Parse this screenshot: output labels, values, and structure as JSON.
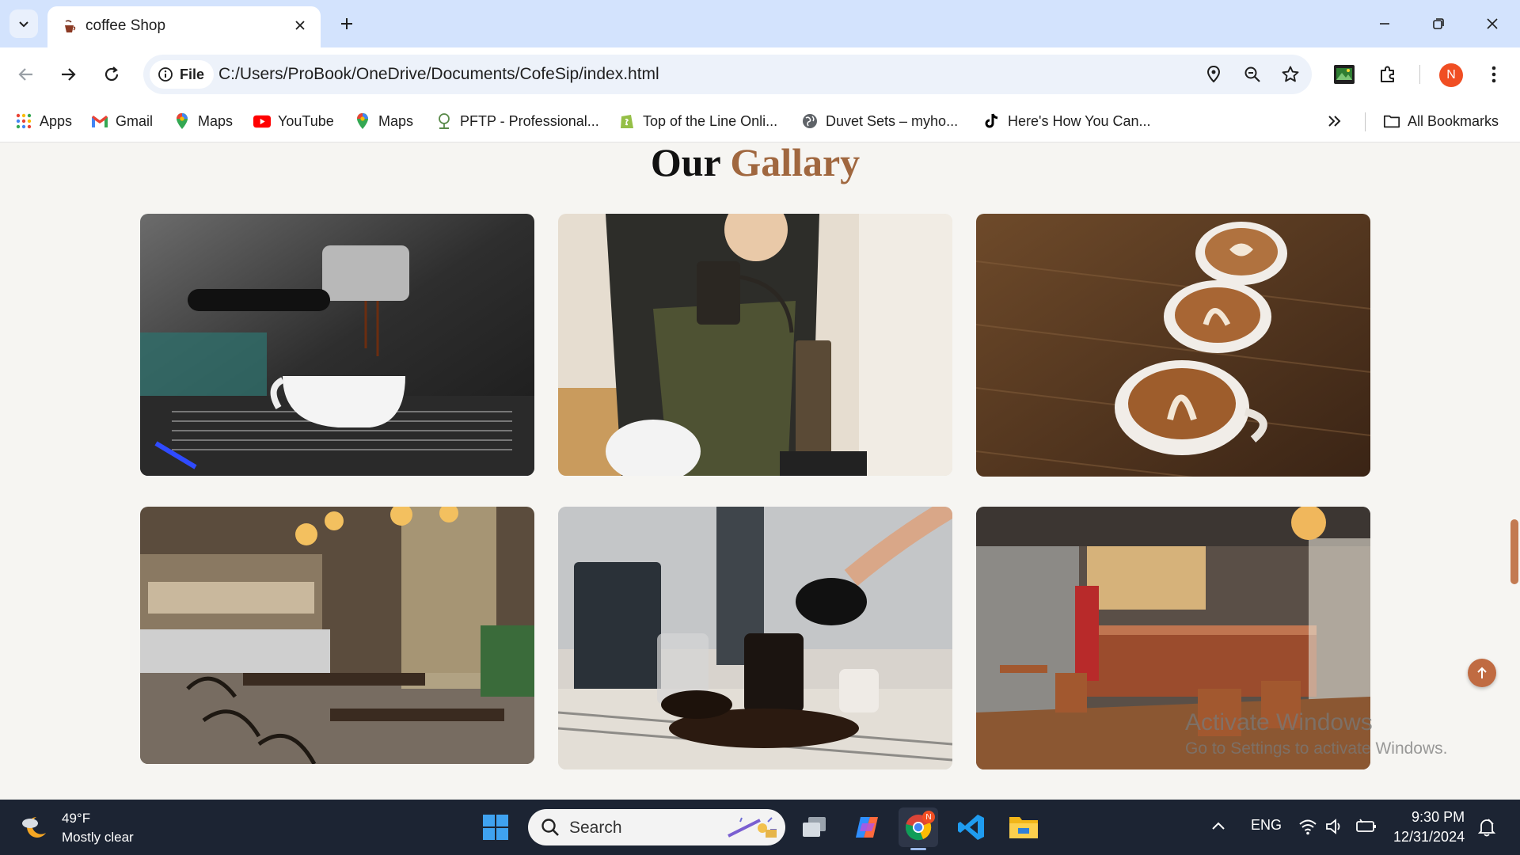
{
  "browser": {
    "tab": {
      "title": "coffee Shop"
    },
    "omnibox": {
      "security_chip": "File",
      "url": "C:/Users/ProBook/OneDrive/Documents/CofeSip/index.html"
    },
    "profile_initial": "N",
    "bookmarks": [
      {
        "label": "Apps",
        "icon": "apps-grid-icon"
      },
      {
        "label": "Gmail",
        "icon": "gmail-icon"
      },
      {
        "label": "Maps",
        "icon": "maps-pin-icon"
      },
      {
        "label": "YouTube",
        "icon": "youtube-icon"
      },
      {
        "label": "Maps",
        "icon": "maps-pin-icon"
      },
      {
        "label": "PFTP - Professional...",
        "icon": "pftp-icon"
      },
      {
        "label": "Top of the Line Onli...",
        "icon": "shopify-icon"
      },
      {
        "label": "Duvet Sets – myho...",
        "icon": "globe-icon"
      },
      {
        "label": "Here's How You Can...",
        "icon": "tiktok-icon"
      }
    ],
    "all_bookmarks": "All Bookmarks"
  },
  "page": {
    "heading_part1": "Our",
    "heading_part2": "Gallary",
    "gallery": [
      {
        "subject": "espresso-machine-cup"
      },
      {
        "subject": "barista-pour-over"
      },
      {
        "subject": "latte-art-cups"
      },
      {
        "subject": "cafe-interior"
      },
      {
        "subject": "coffee-pour-beans"
      },
      {
        "subject": "coffee-shop-counter"
      }
    ],
    "watermark": {
      "line1": "Activate Windows",
      "line2": "Go to Settings to activate Windows."
    },
    "accent_color": "#a0673f"
  },
  "taskbar": {
    "weather": {
      "temp": "49°F",
      "condition": "Mostly clear"
    },
    "search_placeholder": "Search",
    "language": "ENG",
    "time": "9:30 PM",
    "date": "12/31/2024"
  }
}
